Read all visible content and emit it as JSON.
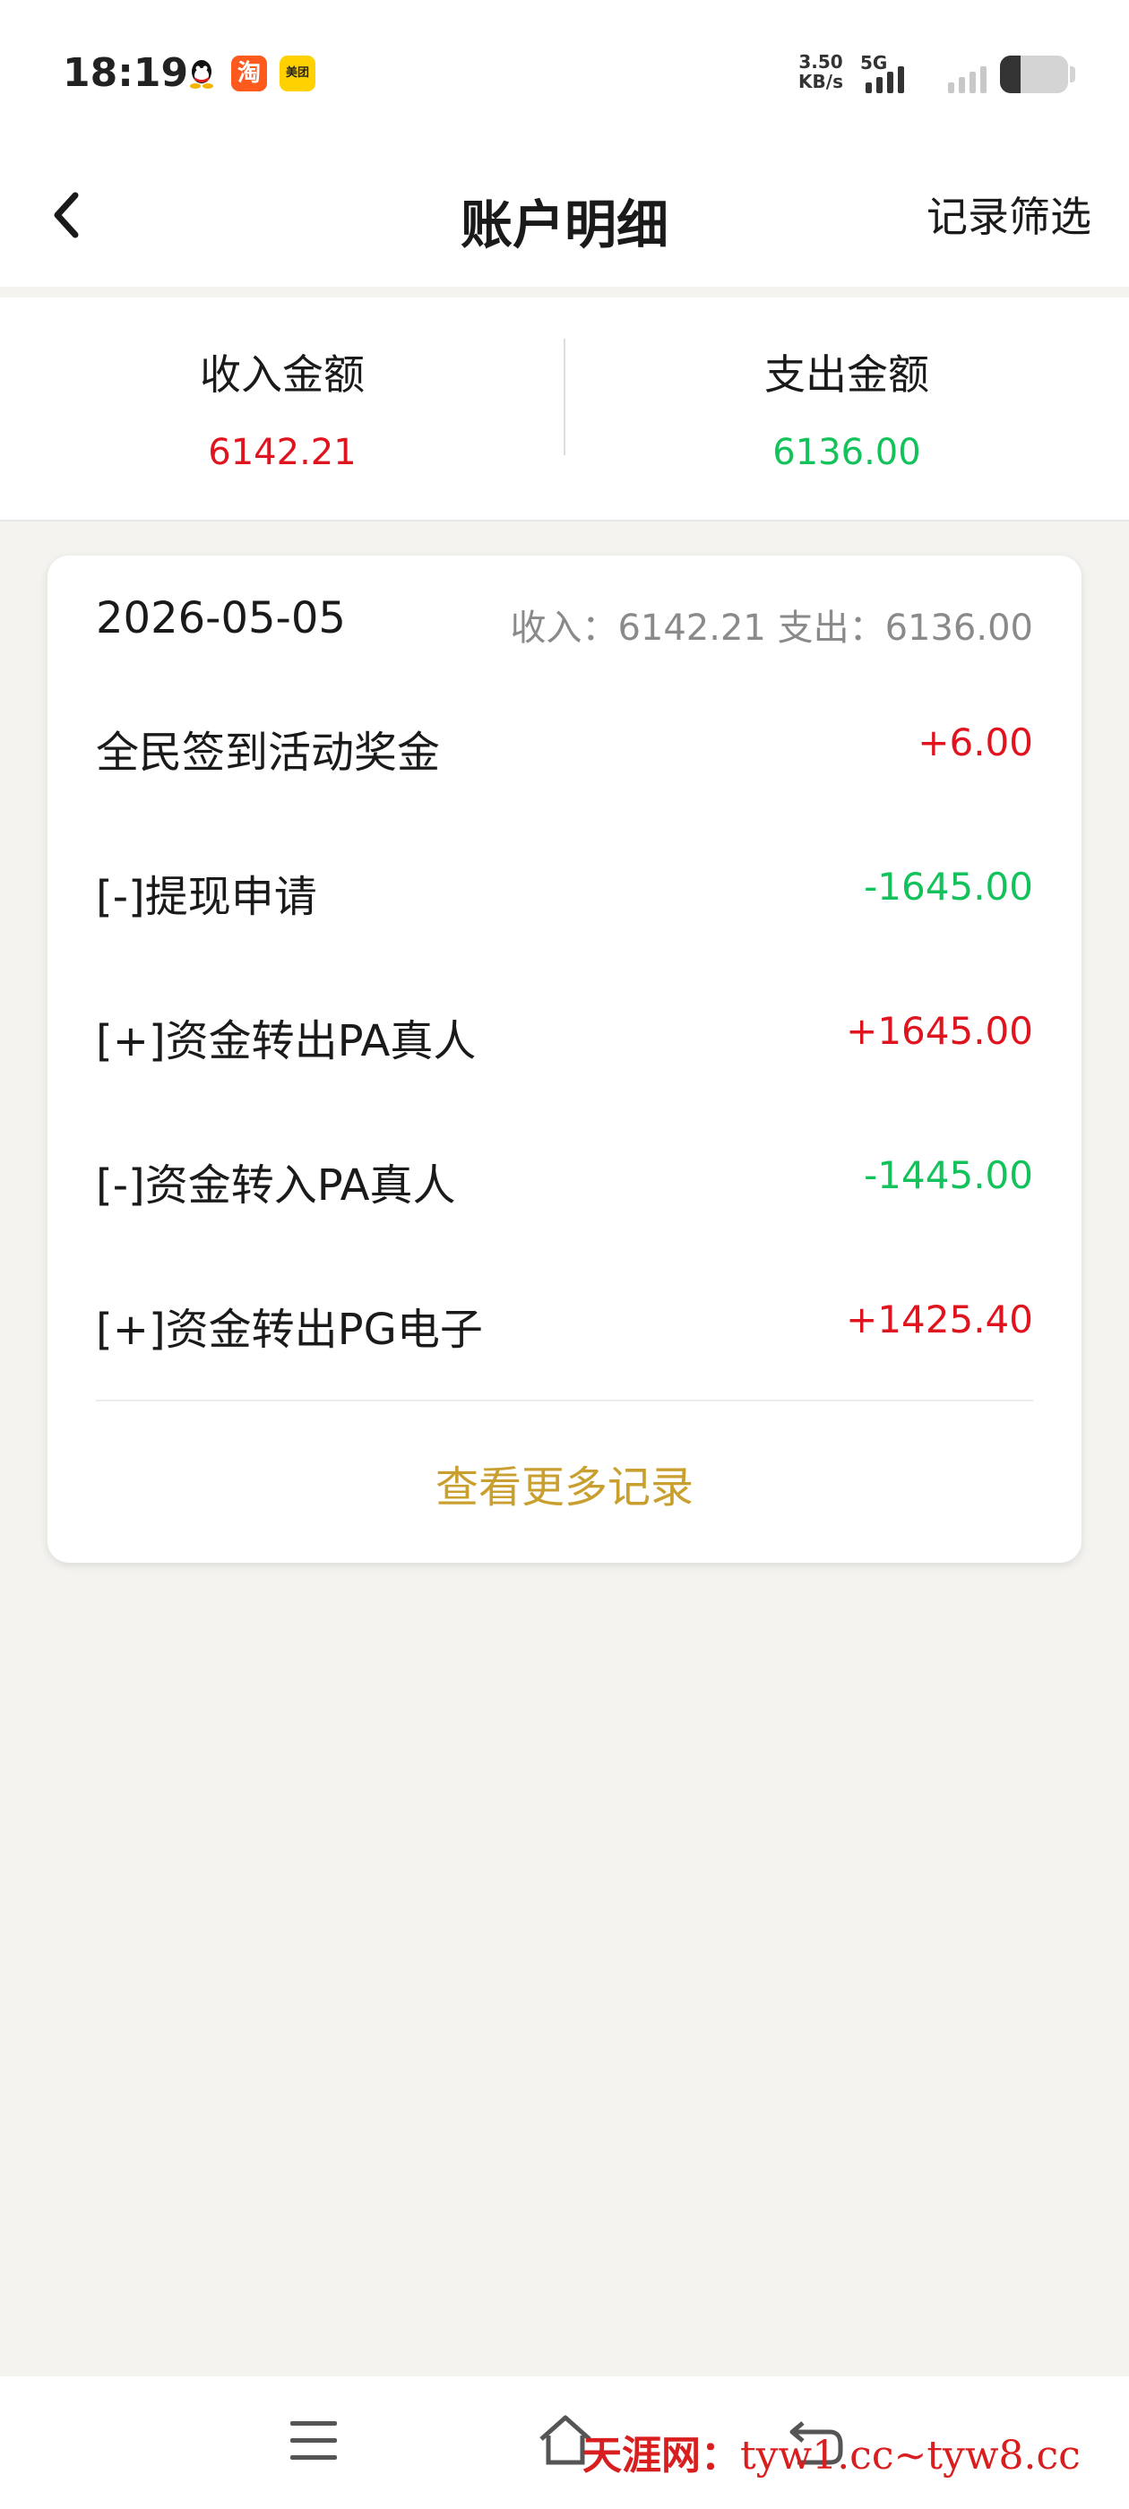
{
  "status_bar": {
    "time": "18:19",
    "app_icons": [
      "qq-icon",
      "taobao-icon",
      "meituan-icon"
    ],
    "taobao_text": "淘",
    "meituan_text": "美团",
    "net_speed_value": "3.50",
    "net_speed_unit": "KB/s",
    "network_type": "5G",
    "battery_level": 0.3
  },
  "nav": {
    "back_icon": "chevron-left-icon",
    "title": "账户明细",
    "filter_label": "记录筛选"
  },
  "summary": {
    "income_label": "收入金额",
    "income_value": "6142.21",
    "expense_label": "支出金额",
    "expense_value": "6136.00"
  },
  "day_card": {
    "date": "2026-05-05",
    "income_prefix": "收入：",
    "income_total": "6142.21",
    "expense_prefix": "支出：",
    "expense_total": "6136.00",
    "records": [
      {
        "label": "全民签到活动奖金",
        "amount": "+6.00",
        "kind": "income"
      },
      {
        "label": "[-]提现申请",
        "amount": "-1645.00",
        "kind": "expense"
      },
      {
        "label": "[+]资金转出PA真人",
        "amount": "+1645.00",
        "kind": "income"
      },
      {
        "label": "[-]资金转入PA真人",
        "amount": "-1445.00",
        "kind": "expense"
      },
      {
        "label": "[+]资金转出PG电子",
        "amount": "+1425.40",
        "kind": "income"
      }
    ],
    "view_more_label": "查看更多记录"
  },
  "system_nav": {
    "menu_icon": "menu-icon",
    "home_icon": "home-icon",
    "back_icon": "back-icon"
  },
  "watermark": {
    "name": "天涯网：",
    "url": "tyw1.cc~tyw8.cc"
  },
  "colors": {
    "income": "#e0141e",
    "expense": "#13c25a",
    "accent": "#c9a030",
    "background": "#f4f3ef"
  }
}
